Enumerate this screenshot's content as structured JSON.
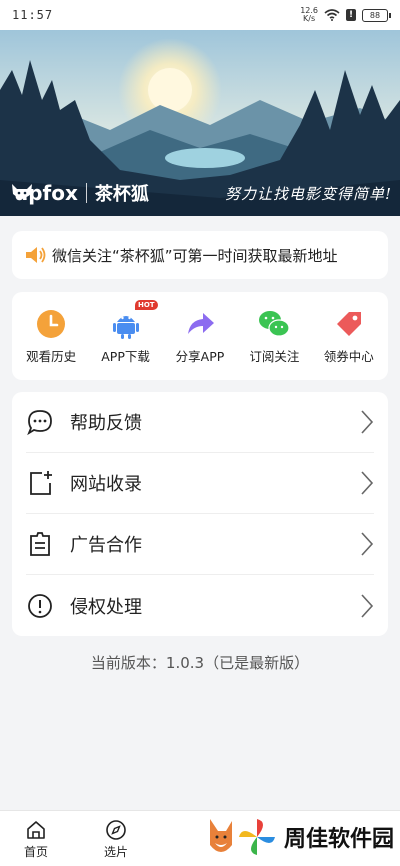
{
  "status_bar": {
    "time": "11:57",
    "net_speed_value": "12.6",
    "net_speed_unit": "K/s",
    "sim_badge": "!",
    "battery": "88"
  },
  "banner": {
    "brand_name": "upfox",
    "brand_cn": "茶杯狐",
    "slogan": "努力让找电影变得简单!"
  },
  "notice": {
    "text": "微信关注“茶杯狐”可第一时间获取最新地址"
  },
  "quick_actions": [
    {
      "label": "观看历史",
      "icon": "clock-icon",
      "color": "#f4a23a"
    },
    {
      "label": "APP下载",
      "icon": "android-icon",
      "color": "#4a8df0",
      "badge": "HOT"
    },
    {
      "label": "分享APP",
      "icon": "share-arrow-icon",
      "color": "#8c6cf0"
    },
    {
      "label": "订阅关注",
      "icon": "wechat-icon",
      "color": "#3bc453"
    },
    {
      "label": "领券中心",
      "icon": "coupon-tag-icon",
      "color": "#ec5a5a"
    }
  ],
  "menu": [
    {
      "label": "帮助反馈",
      "icon": "chat-bubble-icon"
    },
    {
      "label": "网站收录",
      "icon": "add-page-icon"
    },
    {
      "label": "广告合作",
      "icon": "document-icon"
    },
    {
      "label": "侵权处理",
      "icon": "alert-circle-icon"
    }
  ],
  "version_text": "当前版本：1.0.3（已是最新版）",
  "tabbar": {
    "home": "首页",
    "picks": "选片"
  },
  "watermark": {
    "text": "周佳软件园"
  }
}
